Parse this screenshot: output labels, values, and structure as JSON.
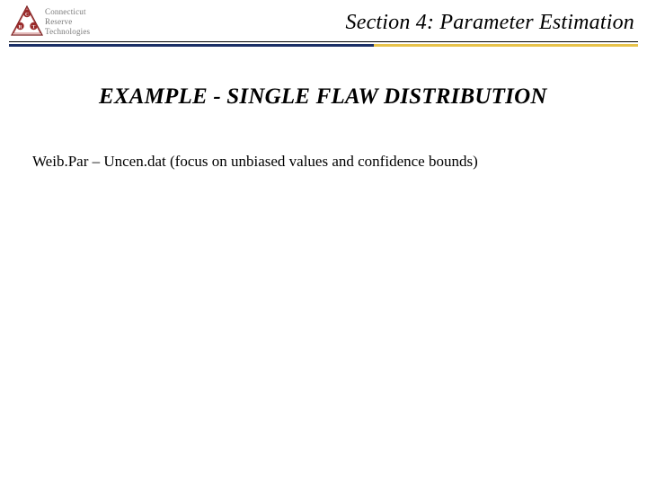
{
  "header": {
    "logo": {
      "line1": "Connecticut",
      "line2": "Reserve",
      "line3": "Technologies"
    },
    "section_title": "Section 4: Parameter Estimation"
  },
  "content": {
    "heading": "EXAMPLE - SINGLE FLAW DISTRIBUTION",
    "body": "Weib.Par – Uncen.dat (focus on unbiased values and confidence bounds)"
  }
}
